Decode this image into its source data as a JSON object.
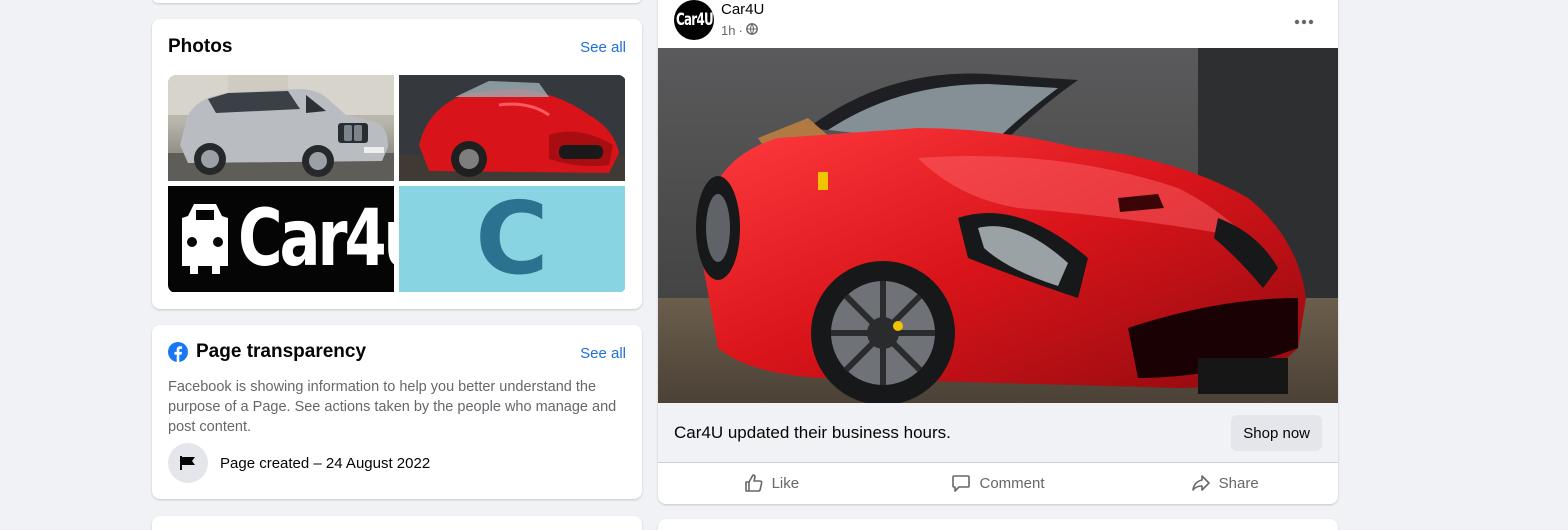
{
  "photos_card": {
    "title": "Photos",
    "see_all": "See all",
    "photos": [
      {
        "label": "silver SUV photo"
      },
      {
        "label": "red convertible photo"
      },
      {
        "label": "Car4u"
      },
      {
        "label": "C"
      }
    ]
  },
  "transparency_card": {
    "title": "Page transparency",
    "see_all": "See all",
    "description": "Facebook is showing information to help you better understand the purpose of a Page. See actions taken by the people who manage and post content.",
    "page_created": "Page created – 24 August 2022"
  },
  "post": {
    "author": "Car4U",
    "avatar_text": "Car4U",
    "time": "1h",
    "separator": "·",
    "update_text": "Car4U updated their business hours.",
    "shop_button": "Shop now",
    "actions": {
      "like": "Like",
      "comment": "Comment",
      "share": "Share"
    }
  },
  "colors": {
    "background": "#f0f2f5",
    "link": "#216fdb",
    "facebook_blue": "#1877f2",
    "secondary_text": "#65676b",
    "car_red": "#d8141a"
  }
}
